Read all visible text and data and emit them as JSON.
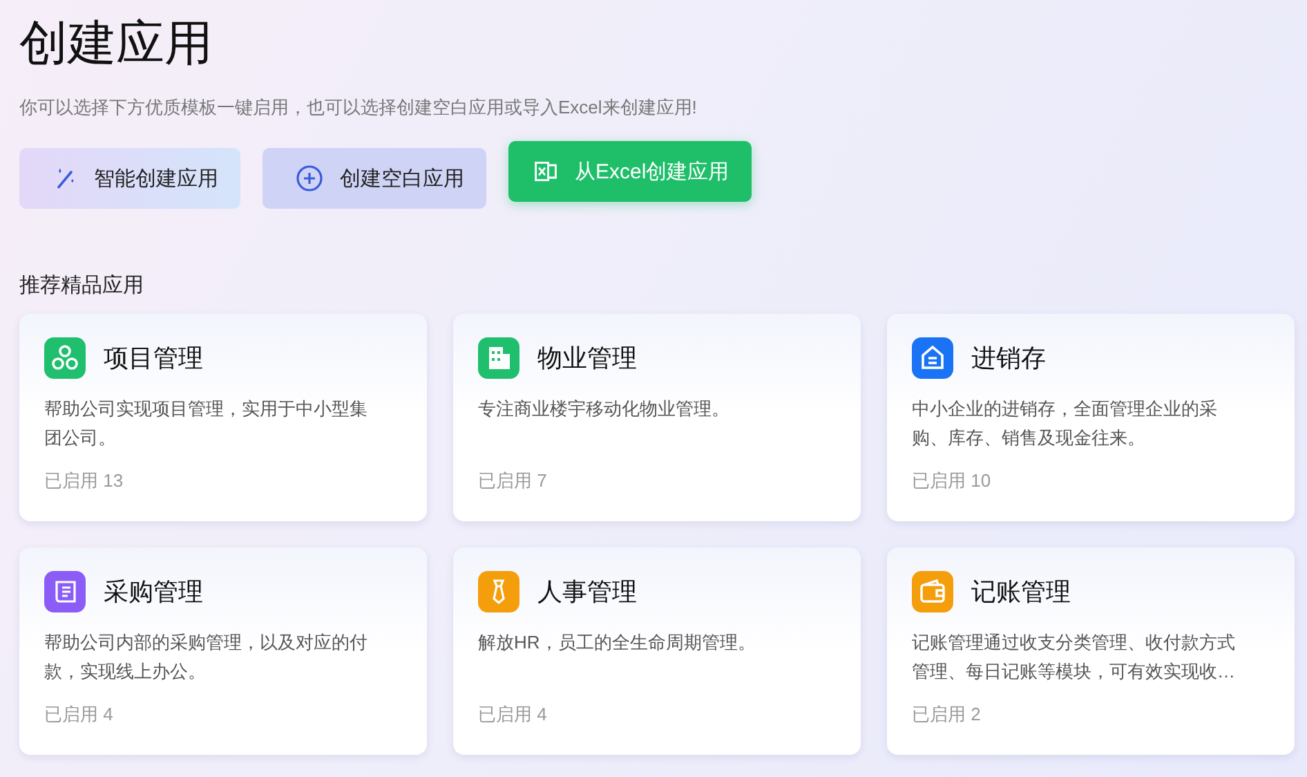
{
  "title": "创建应用",
  "subtitle": "你可以选择下方优质模板一键启用，也可以选择创建空白应用或导入Excel来创建应用!",
  "buttons": [
    {
      "label": "智能创建应用",
      "kind": "ai"
    },
    {
      "label": "创建空白应用",
      "kind": "blank"
    },
    {
      "label": "从Excel创建应用",
      "kind": "excel"
    }
  ],
  "section_title": "推荐精品应用",
  "apps": [
    {
      "name": "项目管理",
      "description": "帮助公司实现项目管理，实用于中小型集团公司。",
      "usage": "已启用 13",
      "kind": "circles",
      "color": "#1fbf6e"
    },
    {
      "name": "物业管理",
      "description": "专注商业楼宇移动化物业管理。",
      "usage": "已启用 7",
      "kind": "building",
      "color": "#1fbf6e"
    },
    {
      "name": "进销存",
      "description": "中小企业的进销存，全面管理企业的采购、库存、销售及现金往来。",
      "usage": "已启用 10",
      "kind": "house",
      "color": "#1a73f5"
    },
    {
      "name": "采购管理",
      "description": "帮助公司内部的采购管理，以及对应的付款，实现线上办公。",
      "usage": "已启用 4",
      "kind": "note",
      "color": "#8b5cf6"
    },
    {
      "name": "人事管理",
      "description": "解放HR，员工的全生命周期管理。",
      "usage": "已启用 4",
      "kind": "tie",
      "color": "#f59e0b"
    },
    {
      "name": "记账管理",
      "description": "记账管理通过收支分类管理、收付款方式管理、每日记账等模块，可有效实现收…",
      "usage": "已启用 2",
      "kind": "wallet",
      "color": "#f59e0b"
    }
  ]
}
